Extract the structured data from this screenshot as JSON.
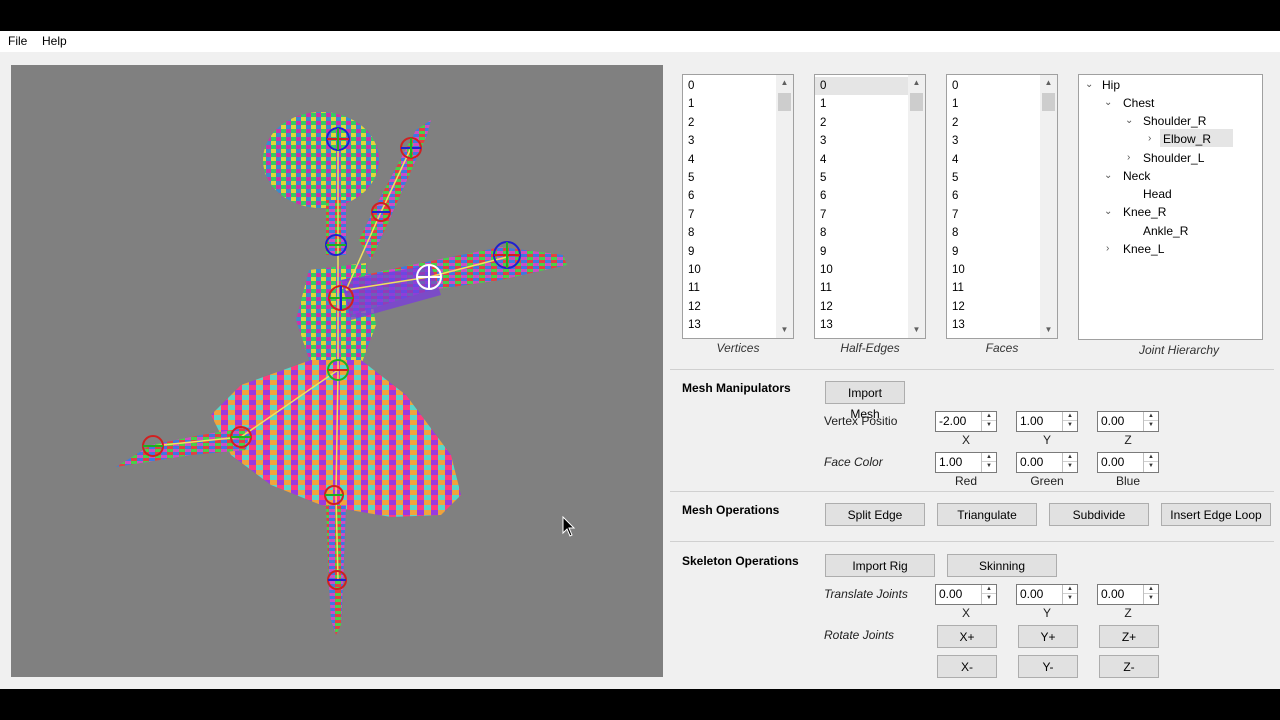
{
  "menu": {
    "file": "File",
    "help": "Help"
  },
  "lists": {
    "vertices": {
      "caption": "Vertices",
      "items": [
        "0",
        "1",
        "2",
        "3",
        "4",
        "5",
        "6",
        "7",
        "8",
        "9",
        "10",
        "11",
        "12",
        "13"
      ]
    },
    "half_edges": {
      "caption": "Half-Edges",
      "items": [
        "0",
        "1",
        "2",
        "3",
        "4",
        "5",
        "6",
        "7",
        "8",
        "9",
        "10",
        "11",
        "12",
        "13"
      ],
      "selected": "0"
    },
    "faces": {
      "caption": "Faces",
      "items": [
        "0",
        "1",
        "2",
        "3",
        "4",
        "5",
        "6",
        "7",
        "8",
        "9",
        "10",
        "11",
        "12",
        "13"
      ]
    }
  },
  "joint_hierarchy": {
    "caption": "Joint Hierarchy",
    "nodes": {
      "hip": "Hip",
      "chest": "Chest",
      "shoulder_r": "Shoulder_R",
      "elbow_r": "Elbow_R",
      "shoulder_l": "Shoulder_L",
      "neck": "Neck",
      "head": "Head",
      "knee_r": "Knee_R",
      "ankle_r": "Ankle_R",
      "knee_l": "Knee_L"
    },
    "selected": "Elbow_R"
  },
  "mesh_manipulators": {
    "title": "Mesh Manipulators",
    "import_mesh": "Import Mesh",
    "vertex_position_label": "Vertex Positio",
    "vertex_position": {
      "x": "-2.00",
      "y": "1.00",
      "z": "0.00"
    },
    "axis": {
      "x": "X",
      "y": "Y",
      "z": "Z"
    },
    "face_color_label": "Face Color",
    "face_color": {
      "red": "1.00",
      "green": "0.00",
      "blue": "0.00"
    },
    "color_labels": {
      "red": "Red",
      "green": "Green",
      "blue": "Blue"
    }
  },
  "mesh_operations": {
    "title": "Mesh Operations",
    "split_edge": "Split Edge",
    "triangulate": "Triangulate",
    "subdivide": "Subdivide",
    "insert_edge_loop": "Insert Edge Loop"
  },
  "skeleton_operations": {
    "title": "Skeleton Operations",
    "import_rig": "Import Rig",
    "skinning": "Skinning",
    "translate_label": "Translate Joints",
    "translate": {
      "x": "0.00",
      "y": "0.00",
      "z": "0.00"
    },
    "axis": {
      "x": "X",
      "y": "Y",
      "z": "Z"
    },
    "rotate_label": "Rotate Joints",
    "rotate_buttons": {
      "xp": "X+",
      "yp": "Y+",
      "zp": "Z+",
      "xm": "X-",
      "ym": "Y-",
      "zm": "Z-"
    }
  }
}
